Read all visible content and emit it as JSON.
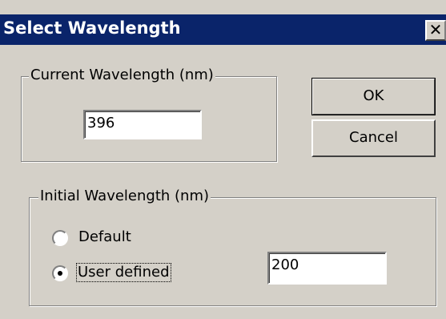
{
  "window": {
    "title": "Select Wavelength",
    "close_icon": "close-icon",
    "close_glyph": "✕"
  },
  "current_group": {
    "legend": "Current Wavelength (nm)",
    "value": "396"
  },
  "buttons": {
    "ok_label": "OK",
    "cancel_label": "Cancel"
  },
  "initial_group": {
    "legend": "Initial Wavelength (nm)",
    "options": [
      {
        "label": "Default",
        "selected": false
      },
      {
        "label": "User defined",
        "selected": true
      }
    ],
    "user_value": "200"
  },
  "colors": {
    "title_bar": "#0a246a",
    "dialog_bg": "#d4d0c8"
  }
}
